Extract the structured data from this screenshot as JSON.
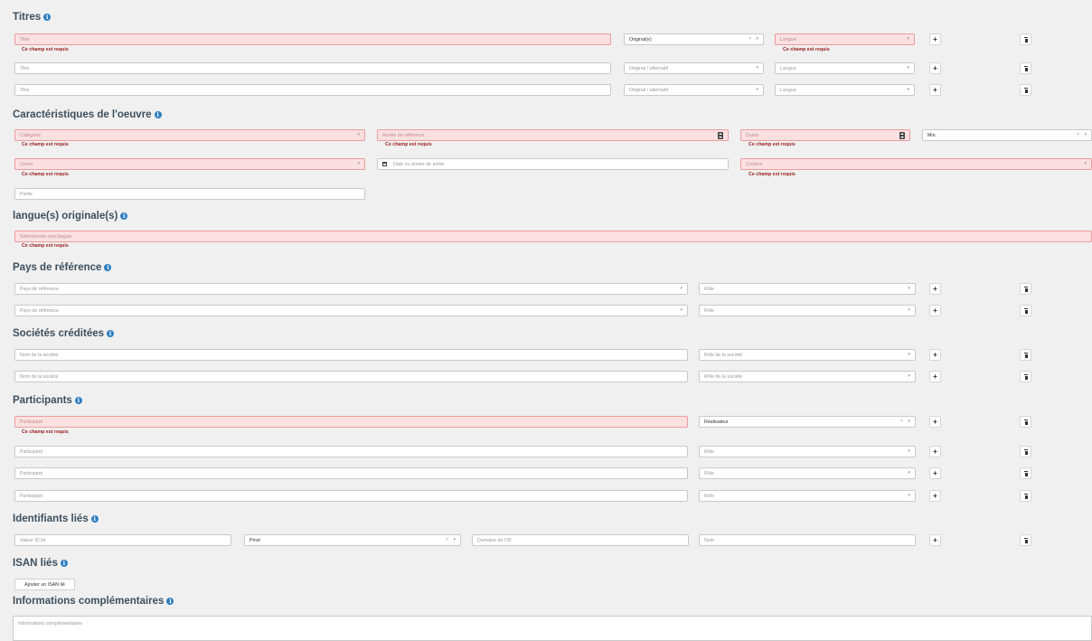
{
  "required_error": "Ce champ est requis",
  "sections": {
    "titres": "Titres",
    "caracteristiques": "Caractéristiques de l'oeuvre",
    "langues": "langue(s) originale(s)",
    "pays": "Pays de référence",
    "societes": "Sociétés créditées",
    "participants": "Participants",
    "identifiants": "Identifiants liés",
    "isan": "ISAN liés",
    "infos": "Informations complémentaires"
  },
  "info_icon": "i",
  "add_label": "+",
  "titres": {
    "rows": [
      {
        "title_placeholder": "Titre",
        "type": "Original(e)",
        "langue": "Langue"
      },
      {
        "title_placeholder": "Titre",
        "type": "Original / alternatif",
        "langue": "Langue"
      },
      {
        "title_placeholder": "Titre",
        "type": "Original / alternatif",
        "langue": "Langue"
      }
    ]
  },
  "caracteristiques": {
    "categorie": "Catégorie",
    "annee_reference": "Année de référence",
    "duree": "Durée",
    "unite": "Min.",
    "genre": "Genre",
    "date_sortie": "Date ou année de sortie",
    "couleur": "Couleur",
    "partie": "Partie"
  },
  "langues": {
    "placeholder": "Sélectionner une langue"
  },
  "pays": {
    "rows": [
      {
        "pays": "Pays de référence",
        "role": "Rôle"
      },
      {
        "pays": "Pays de référence",
        "role": "Rôle"
      }
    ]
  },
  "societes": {
    "rows": [
      {
        "nom": "Nom de la société",
        "role": "Rôle de la société"
      },
      {
        "nom": "Nom de la société",
        "role": "Rôle de la société"
      }
    ]
  },
  "participants": {
    "rows": [
      {
        "nom": "Participant",
        "role": "Réalisateur"
      },
      {
        "nom": "Participant",
        "role": "Rôle"
      },
      {
        "nom": "Participant",
        "role": "Rôle"
      },
      {
        "nom": "Participant",
        "role": "Rôle"
      }
    ]
  },
  "identifiants": {
    "valeur": "Valeur ID lié",
    "visibilite": "Privé",
    "domaine": "Domaine de l'ID",
    "note": "Note"
  },
  "isan": {
    "add_button": "Ajouter un ISAN lié"
  },
  "infos": {
    "placeholder": "Informations complémentaires"
  },
  "colors": {
    "error_bg": "#fbe0e1",
    "error_border": "#ec9c9e",
    "error_text": "#9a1c1c",
    "info_icon": "#2f7ec1",
    "heading": "#3d4f5d"
  }
}
